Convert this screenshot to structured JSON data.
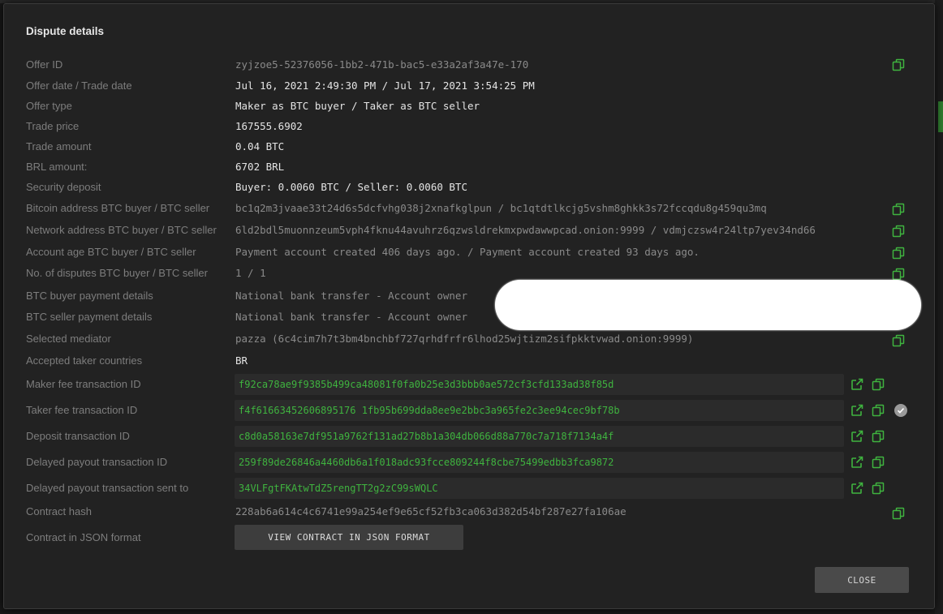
{
  "dialog": {
    "title": "Dispute details"
  },
  "rows": [
    {
      "label": "Offer ID",
      "value": "zyjzoe5-52376056-1bb2-471b-bac5-e33a2af3a47e-170"
    },
    {
      "label": "Offer date / Trade date",
      "value": "Jul 16, 2021 2:49:30 PM / Jul 17, 2021 3:54:25 PM"
    },
    {
      "label": "Offer type",
      "value": "Maker as BTC buyer / Taker as BTC seller"
    },
    {
      "label": "Trade price",
      "value": "167555.6902"
    },
    {
      "label": "Trade amount",
      "value": "0.04 BTC"
    },
    {
      "label": "BRL amount:",
      "value": "6702 BRL"
    },
    {
      "label": "Security deposit",
      "value": "Buyer: 0.0060 BTC / Seller: 0.0060 BTC"
    },
    {
      "label": "Bitcoin address BTC buyer / BTC seller",
      "value": "bc1q2m3jvaae33t24d6s5dcfvhg038j2xnafkglpun / bc1qtdtlkcjg5vshm8ghkk3s72fccqdu8g459qu3mq"
    },
    {
      "label": "Network address BTC buyer / BTC seller",
      "value": "6ld2bdl5muonnzeum5vph4fknu44avuhrz6qzwsldrekmxpwdawwpcad.onion:9999 / vdmjczsw4r24ltp7yev34nd66"
    },
    {
      "label": "Account age BTC buyer / BTC seller",
      "value": "Payment account created 406 days ago. / Payment account created 93 days ago."
    },
    {
      "label": "No. of disputes BTC buyer / BTC seller",
      "value": "1 / 1"
    },
    {
      "label": "BTC buyer payment details",
      "value": "National bank transfer - Account owner"
    },
    {
      "label": "BTC seller payment details",
      "value": "National bank transfer - Account owner"
    },
    {
      "label": "Selected mediator",
      "value": "pazza (6c4cim7h7t3bm4bnchbf727qrhdfrfr6lhod25wjtizm2sifpkktvwad.onion:9999)"
    },
    {
      "label": "Accepted taker countries",
      "value": "BR"
    }
  ],
  "transactions": [
    {
      "label": "Maker fee transaction ID",
      "value": "f92ca78ae9f9385b499ca48081f0fa0b25e3d3bbb0ae572cf3cfd133ad38f85d"
    },
    {
      "label": "Taker fee transaction ID",
      "value": "f4f61663452606895176 1fb95b699dda8ee9e2bbc3a965fe2c3ee94cec9bf78b"
    },
    {
      "label": "Deposit transaction ID",
      "value": "c8d0a58163e7df951a9762f131ad27b8b1a304db066d88a770c7a718f7134a4f"
    },
    {
      "label": "Delayed payout transaction ID",
      "value": "259f89de26846a4460db6a1f018adc93fcce809244f8cbe75499edbb3fca9872"
    },
    {
      "label": "Delayed payout transaction sent to",
      "value": "34VLFgtFKAtwTdZ5rengTT2g2zC99sWQLC"
    }
  ],
  "contract": {
    "hash_label": "Contract hash",
    "hash_value": "228ab6a614c4c6741e99a254ef9e65cf52fb3ca063d382d54bf287e27fa106ae",
    "json_label": "Contract in JSON format",
    "json_button": "VIEW CONTRACT IN JSON FORMAT"
  },
  "buttons": {
    "close": "CLOSE"
  },
  "colors": {
    "accent_green": "#3fb33f",
    "dim_text": "#7d7d7d",
    "bright_text": "#e4e4e4",
    "panel": "#222222"
  }
}
